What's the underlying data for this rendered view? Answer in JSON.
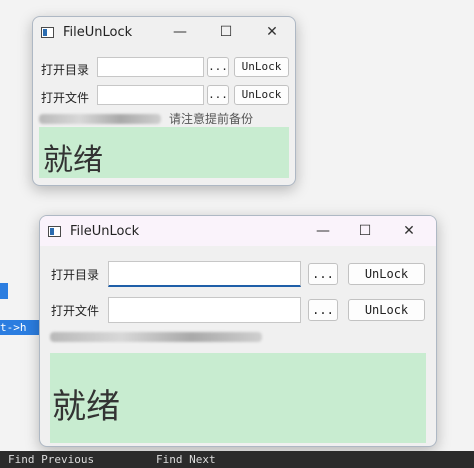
{
  "app": {
    "title": "FileUnLock"
  },
  "labels": {
    "open_dir": "打开目录",
    "open_file": "打开文件"
  },
  "buttons": {
    "browse": "...",
    "unlock": "UnLock"
  },
  "notice": {
    "text": "请注意提前备份"
  },
  "status": {
    "text": "就绪",
    "background": "#c8ecd0"
  },
  "window_controls": {
    "minimize": "—",
    "maximize": "☐",
    "close": "✕"
  },
  "editor": {
    "code_fragment": "t->h",
    "find_previous": "Find Previous",
    "find_next": "Find Next"
  },
  "colors": {
    "accent": "#2b7de0",
    "status_green": "#c8ecd0",
    "focus_line": "#1f5fa8"
  }
}
